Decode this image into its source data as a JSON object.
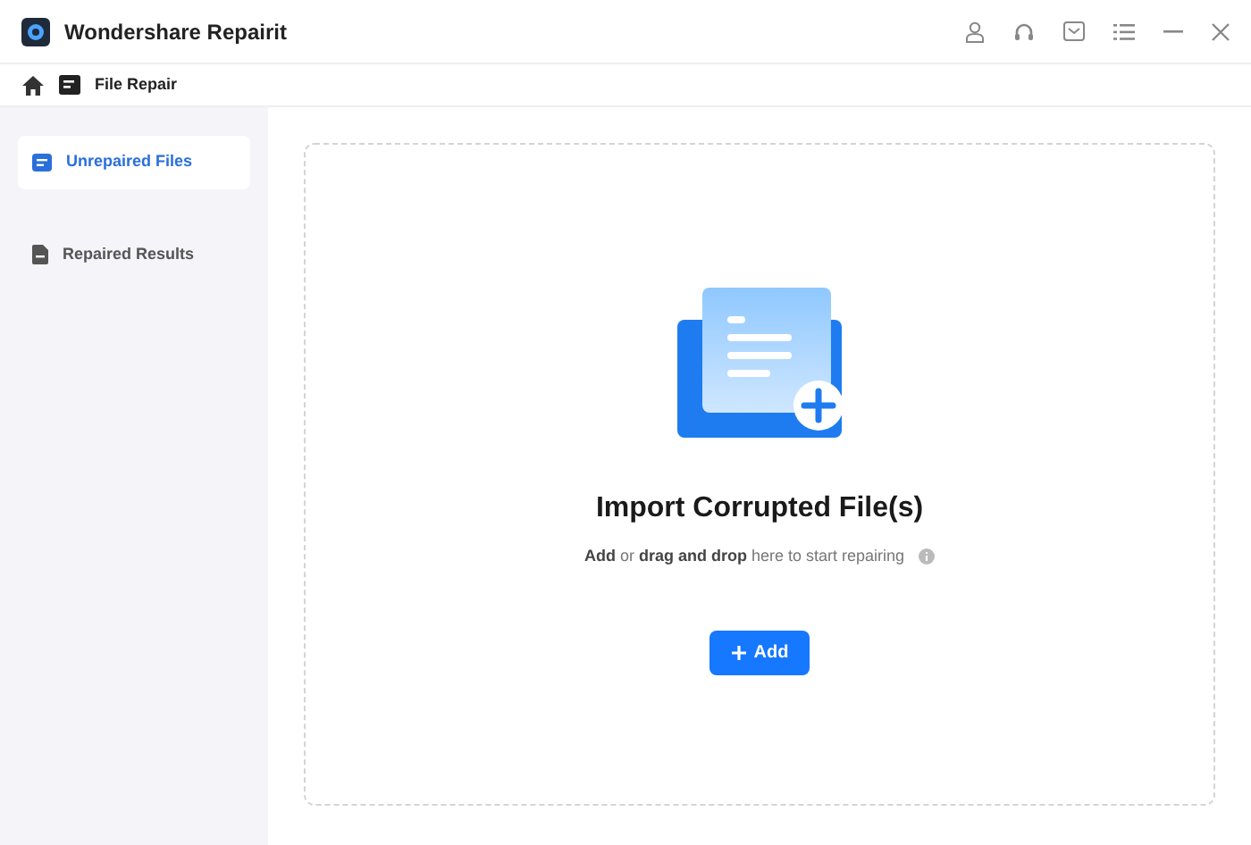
{
  "window": {
    "title": "Wondershare Repairit"
  },
  "breadcrumb": {
    "label": "File Repair"
  },
  "sidebar": {
    "items": [
      {
        "label": "Unrepaired Files",
        "selected": true
      },
      {
        "label": "Repaired Results",
        "selected": false
      }
    ]
  },
  "drop_zone": {
    "title": "Import Corrupted File(s)",
    "hint": "**Add** or **drag and drop** here to start repairing",
    "button": "Add"
  }
}
